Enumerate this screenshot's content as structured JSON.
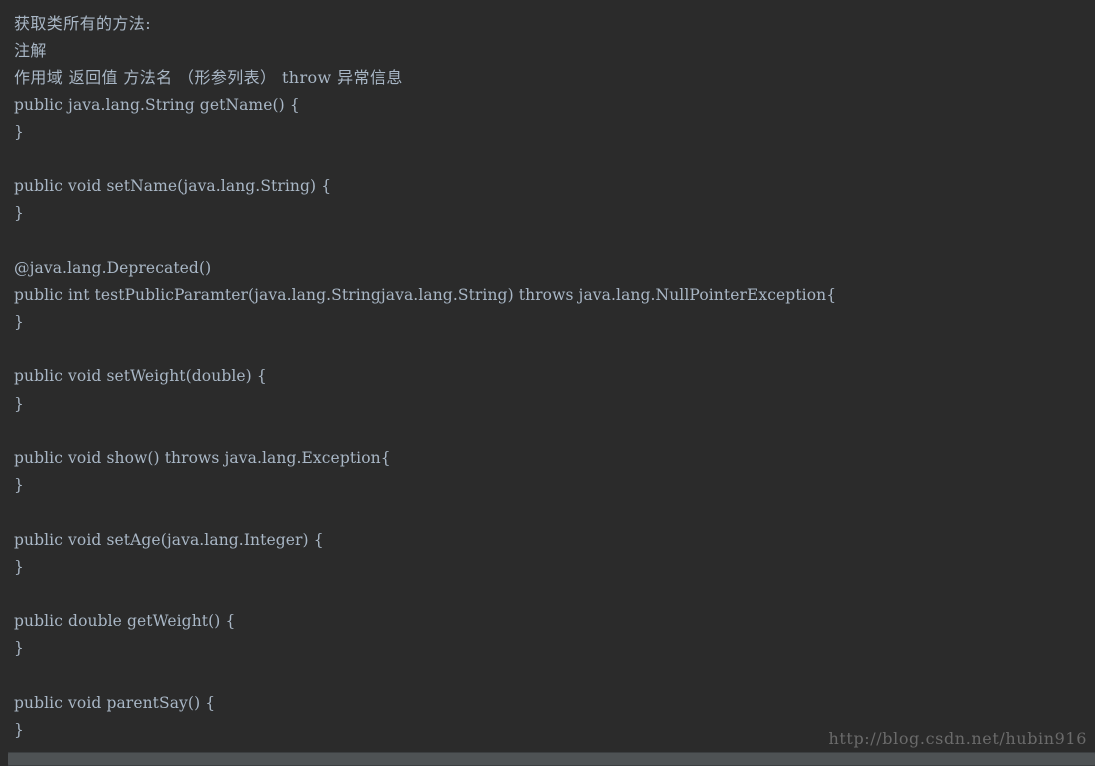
{
  "window": {
    "background_color": "#2b2b2b",
    "foreground_color": "#a9b7c6"
  },
  "console": {
    "name": "java-reflection-output",
    "lines": [
      {
        "text": "获取类所有的方法:",
        "cjk": true
      },
      {
        "text": "注解",
        "cjk": true
      },
      {
        "text": "作用域 返回值 方法名 （形参列表） throw 异常信息",
        "cjk": true
      },
      {
        "text": "public java.lang.String getName() {",
        "cjk": false
      },
      {
        "text": "}",
        "cjk": false
      },
      {
        "text": "",
        "cjk": false
      },
      {
        "text": "public void setName(java.lang.String) {",
        "cjk": false
      },
      {
        "text": "}",
        "cjk": false
      },
      {
        "text": "",
        "cjk": false
      },
      {
        "text": "@java.lang.Deprecated()",
        "cjk": false
      },
      {
        "text": "public int testPublicParamter(java.lang.Stringjava.lang.String) throws java.lang.NullPointerException{",
        "cjk": false
      },
      {
        "text": "}",
        "cjk": false
      },
      {
        "text": "",
        "cjk": false
      },
      {
        "text": "public void setWeight(double) {",
        "cjk": false
      },
      {
        "text": "}",
        "cjk": false
      },
      {
        "text": "",
        "cjk": false
      },
      {
        "text": "public void show() throws java.lang.Exception{",
        "cjk": false
      },
      {
        "text": "}",
        "cjk": false
      },
      {
        "text": "",
        "cjk": false
      },
      {
        "text": "public void setAge(java.lang.Integer) {",
        "cjk": false
      },
      {
        "text": "}",
        "cjk": false
      },
      {
        "text": "",
        "cjk": false
      },
      {
        "text": "public double getWeight() {",
        "cjk": false
      },
      {
        "text": "}",
        "cjk": false
      },
      {
        "text": "",
        "cjk": false
      },
      {
        "text": "public void parentSay() {",
        "cjk": false
      },
      {
        "text": "}",
        "cjk": false
      }
    ]
  },
  "watermark": {
    "text": "http://blog.csdn.net/hubin916",
    "color": "#6b6b6b"
  },
  "scrollbar": {
    "orientation": "horizontal",
    "track_color": "#3c3f41",
    "thumb_color": "#4e5254"
  }
}
